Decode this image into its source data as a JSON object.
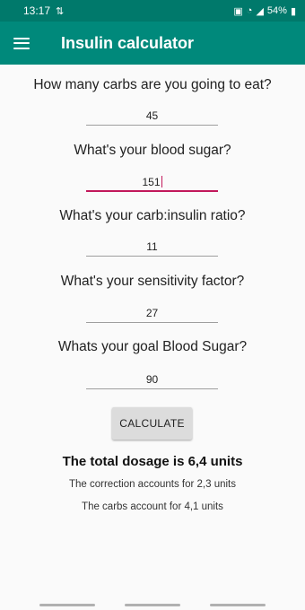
{
  "status_bar": {
    "time": "13:17",
    "left_icon": "signal-arrows-icon",
    "battery": "54%"
  },
  "app_bar": {
    "title": "Insulin calculator",
    "menu_icon": "hamburger-menu-icon",
    "color": "#00897b"
  },
  "form": {
    "questions": [
      {
        "label": "How many carbs are you going to eat?",
        "value": "45"
      },
      {
        "label": "What's your blood sugar?",
        "value": "151"
      },
      {
        "label": "What's your carb:insulin ratio?",
        "value": "11"
      },
      {
        "label": "What's your sensitivity factor?",
        "value": "27"
      },
      {
        "label": "Whats your goal Blood Sugar?",
        "value": "90"
      }
    ],
    "calculate_label": "CALCULATE"
  },
  "results": {
    "total": "The total dosage is 6,4 units",
    "correction": "The correction accounts for 2,3 units",
    "carbs": "The carbs account for 4,1 units"
  },
  "colors": {
    "status_bar": "#00796b",
    "focus_accent": "#c2185b"
  }
}
